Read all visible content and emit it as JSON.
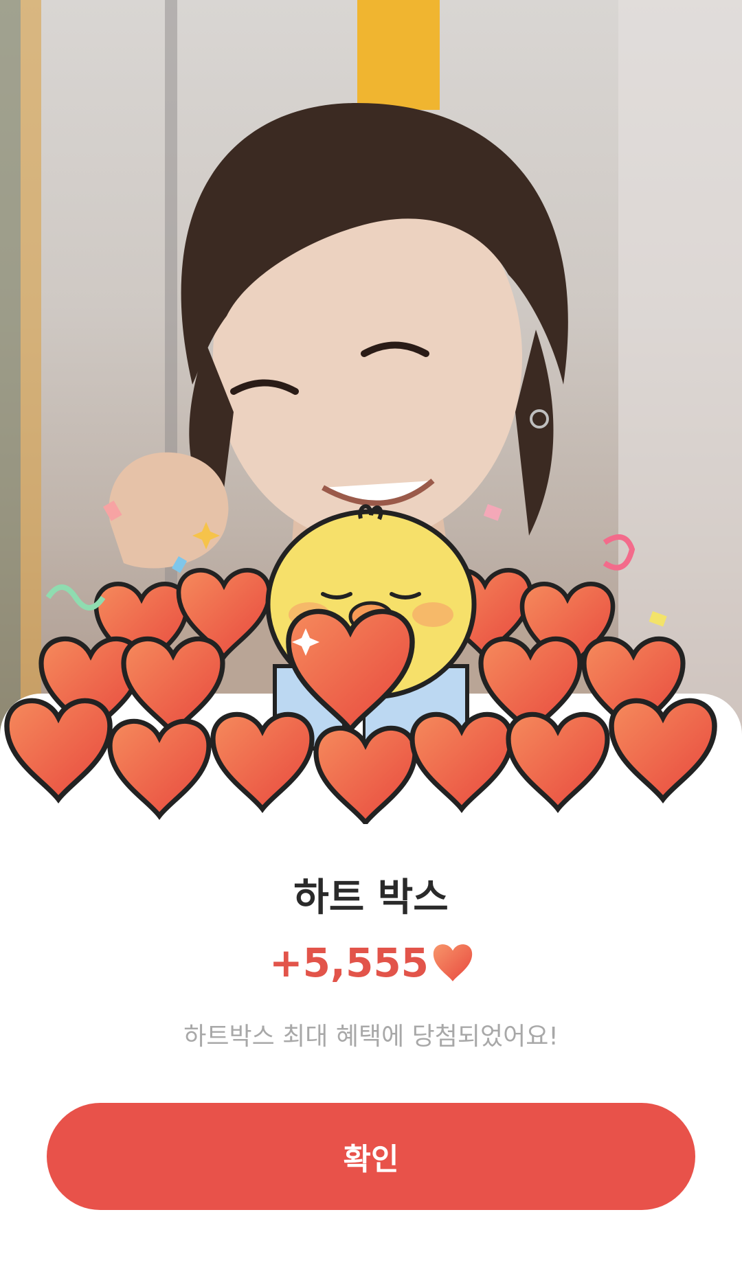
{
  "reward": {
    "title": "하트 박스",
    "amount": "+5,555",
    "currency_icon": "heart-icon",
    "message": "하트박스 최대 혜택에 당첨되었어요!"
  },
  "actions": {
    "confirm_label": "확인"
  },
  "colors": {
    "accent": "#e8524a",
    "amount": "#e2544a",
    "heart": "#f07a55"
  },
  "illustration": {
    "subject": "person-photo",
    "mascot": "yellow-chick-icon",
    "decor": "hearts-pile"
  }
}
